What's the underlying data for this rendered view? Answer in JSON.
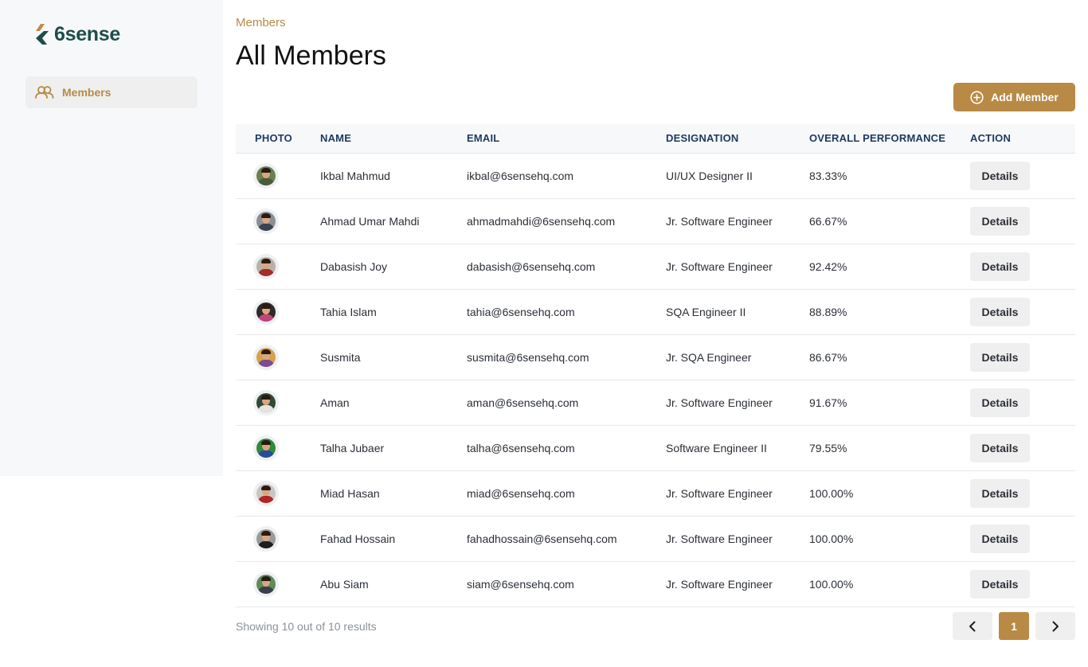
{
  "brand": {
    "name": "6sense",
    "accent": "#b88a45",
    "logo_color": "#1d4e4a"
  },
  "sidebar": {
    "items": [
      {
        "label": "Members",
        "icon": "users-icon",
        "active": true
      }
    ]
  },
  "breadcrumb": "Members",
  "page_title": "All Members",
  "add_button": {
    "label": "Add Member",
    "icon": "plus-circle-icon"
  },
  "table": {
    "headers": [
      "PHOTO",
      "NAME",
      "EMAIL",
      "DESIGNATION",
      "OVERALL PERFORMANCE",
      "ACTION"
    ],
    "rows": [
      {
        "name": "Ikbal Mahmud",
        "email": "ikbal@6sensehq.com",
        "designation": "UI/UX Designer II",
        "performance": "83.33%",
        "action": "Details",
        "avatar": {
          "bg": "#6b7f4f",
          "shirt": "#4a5a3a"
        }
      },
      {
        "name": "Ahmad Umar Mahdi",
        "email": "ahmadmahdi@6sensehq.com",
        "designation": "Jr. Software Engineer",
        "performance": "66.67%",
        "action": "Details",
        "avatar": {
          "bg": "#8a8f95",
          "shirt": "#3b4350"
        }
      },
      {
        "name": "Dabasish Joy",
        "email": "dabasish@6sensehq.com",
        "designation": "Jr. Software Engineer",
        "performance": "92.42%",
        "action": "Details",
        "avatar": {
          "bg": "#b9b2aa",
          "shirt": "#a32c2c"
        }
      },
      {
        "name": "Tahia Islam",
        "email": "tahia@6sensehq.com",
        "designation": "SQA Engineer II",
        "performance": "88.89%",
        "action": "Details",
        "avatar": {
          "bg": "#2b2b2b",
          "shirt": "#c2457a"
        }
      },
      {
        "name": "Susmita",
        "email": "susmita@6sensehq.com",
        "designation": "Jr. SQA Engineer",
        "performance": "86.67%",
        "action": "Details",
        "avatar": {
          "bg": "#d4a24a",
          "shirt": "#7d4b8f"
        }
      },
      {
        "name": "Aman",
        "email": "aman@6sensehq.com",
        "designation": "Jr. Software Engineer",
        "performance": "91.67%",
        "action": "Details",
        "avatar": {
          "bg": "#314a35",
          "shirt": "#e9e4de"
        }
      },
      {
        "name": "Talha Jubaer",
        "email": "talha@6sensehq.com",
        "designation": "Software Engineer II",
        "performance": "79.55%",
        "action": "Details",
        "avatar": {
          "bg": "#2f8a3c",
          "shirt": "#2a4a9a"
        }
      },
      {
        "name": "Miad Hasan",
        "email": "miad@6sensehq.com",
        "designation": "Jr. Software Engineer",
        "performance": "100.00%",
        "action": "Details",
        "avatar": {
          "bg": "#c9c6c2",
          "shirt": "#b32424"
        }
      },
      {
        "name": "Fahad Hossain",
        "email": "fahadhossain@6sensehq.com",
        "designation": "Jr. Software Engineer",
        "performance": "100.00%",
        "action": "Details",
        "avatar": {
          "bg": "#9a9a9a",
          "shirt": "#1f1f1f"
        }
      },
      {
        "name": "Abu Siam",
        "email": "siam@6sensehq.com",
        "designation": "Jr. Software Engineer",
        "performance": "100.00%",
        "action": "Details",
        "avatar": {
          "bg": "#5f8a5a",
          "shirt": "#3a3f47"
        }
      }
    ]
  },
  "pagination": {
    "summary": "Showing 10 out of 10 results",
    "current_page": "1"
  }
}
